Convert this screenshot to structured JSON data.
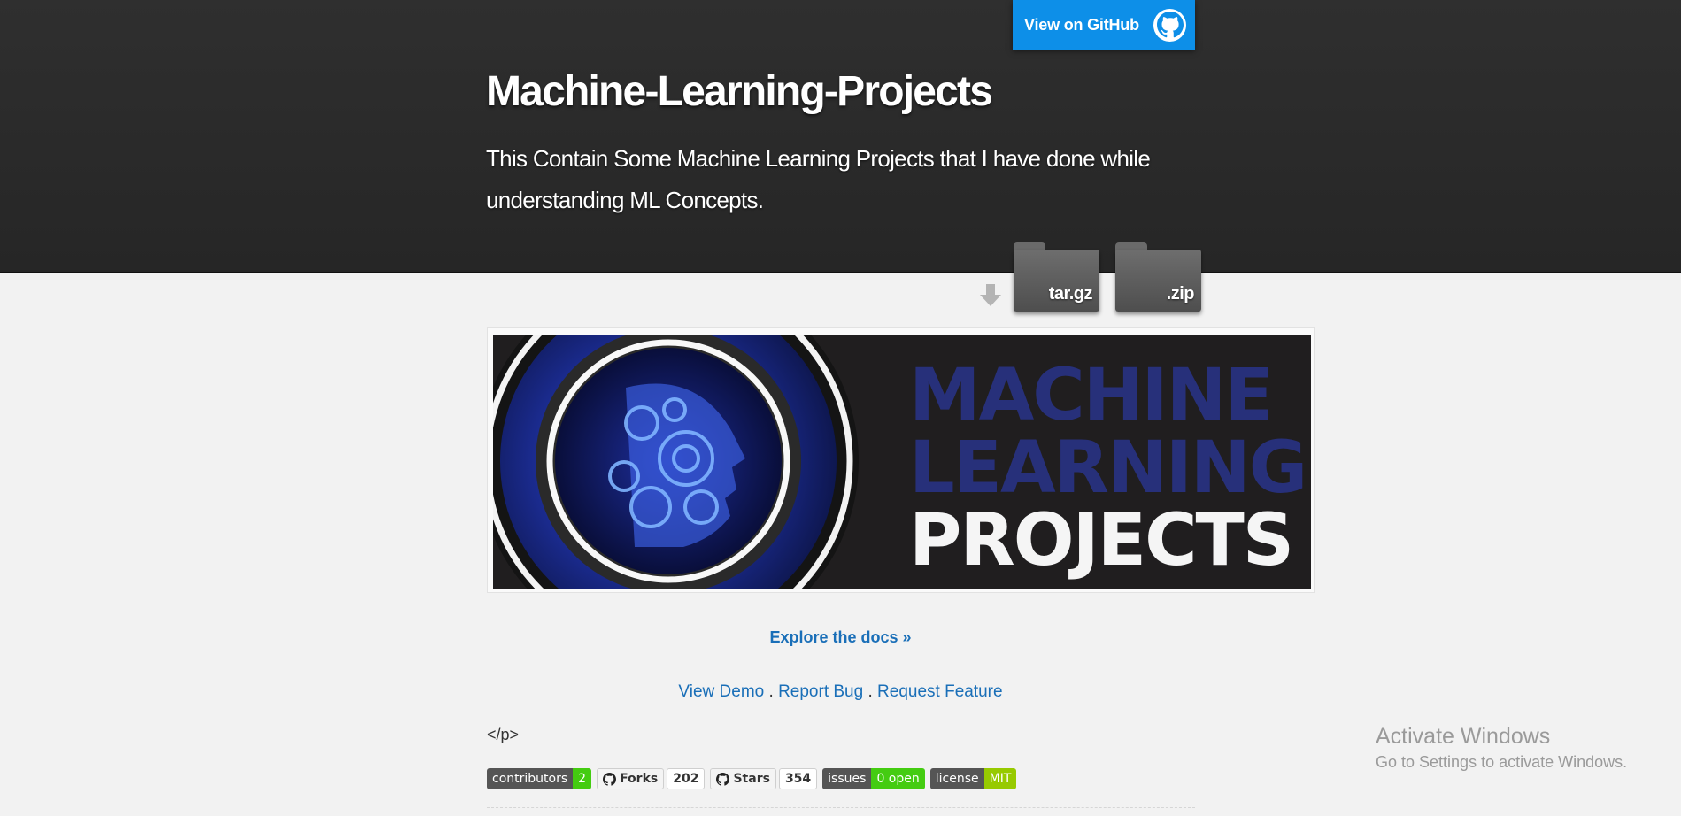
{
  "header": {
    "github_button": "View on GitHub",
    "title": "Machine-Learning-Projects",
    "description": "This Contain Some Machine Learning Projects that I have done while understanding ML Concepts."
  },
  "downloads": {
    "targz": "tar.gz",
    "zip": ".zip"
  },
  "banner": {
    "line1": "MACHINE",
    "line2": "LEARNING",
    "line3": "PROJECTS"
  },
  "links": {
    "explore": "Explore the docs »",
    "view_demo": "View Demo",
    "report_bug": "Report Bug",
    "request_feature": "Request Feature",
    "separator": " . "
  },
  "stray_text": "</p>",
  "badges": {
    "contributors": {
      "label": "contributors",
      "value": "2",
      "color": "#4c1"
    },
    "forks": {
      "label": "Forks",
      "value": "202"
    },
    "stars": {
      "label": "Stars",
      "value": "354"
    },
    "issues": {
      "label": "issues",
      "value": "0 open",
      "color": "#4c1"
    },
    "license": {
      "label": "license",
      "value": "MIT",
      "color": "#97ca00"
    }
  },
  "watermark": {
    "title": "Activate Windows",
    "subtitle": "Go to Settings to activate Windows."
  },
  "colors": {
    "accent": "#0d8fe8",
    "link": "#1a6fb8",
    "header_bg": "#2b2b2b",
    "page_bg": "#f2f2f2"
  }
}
